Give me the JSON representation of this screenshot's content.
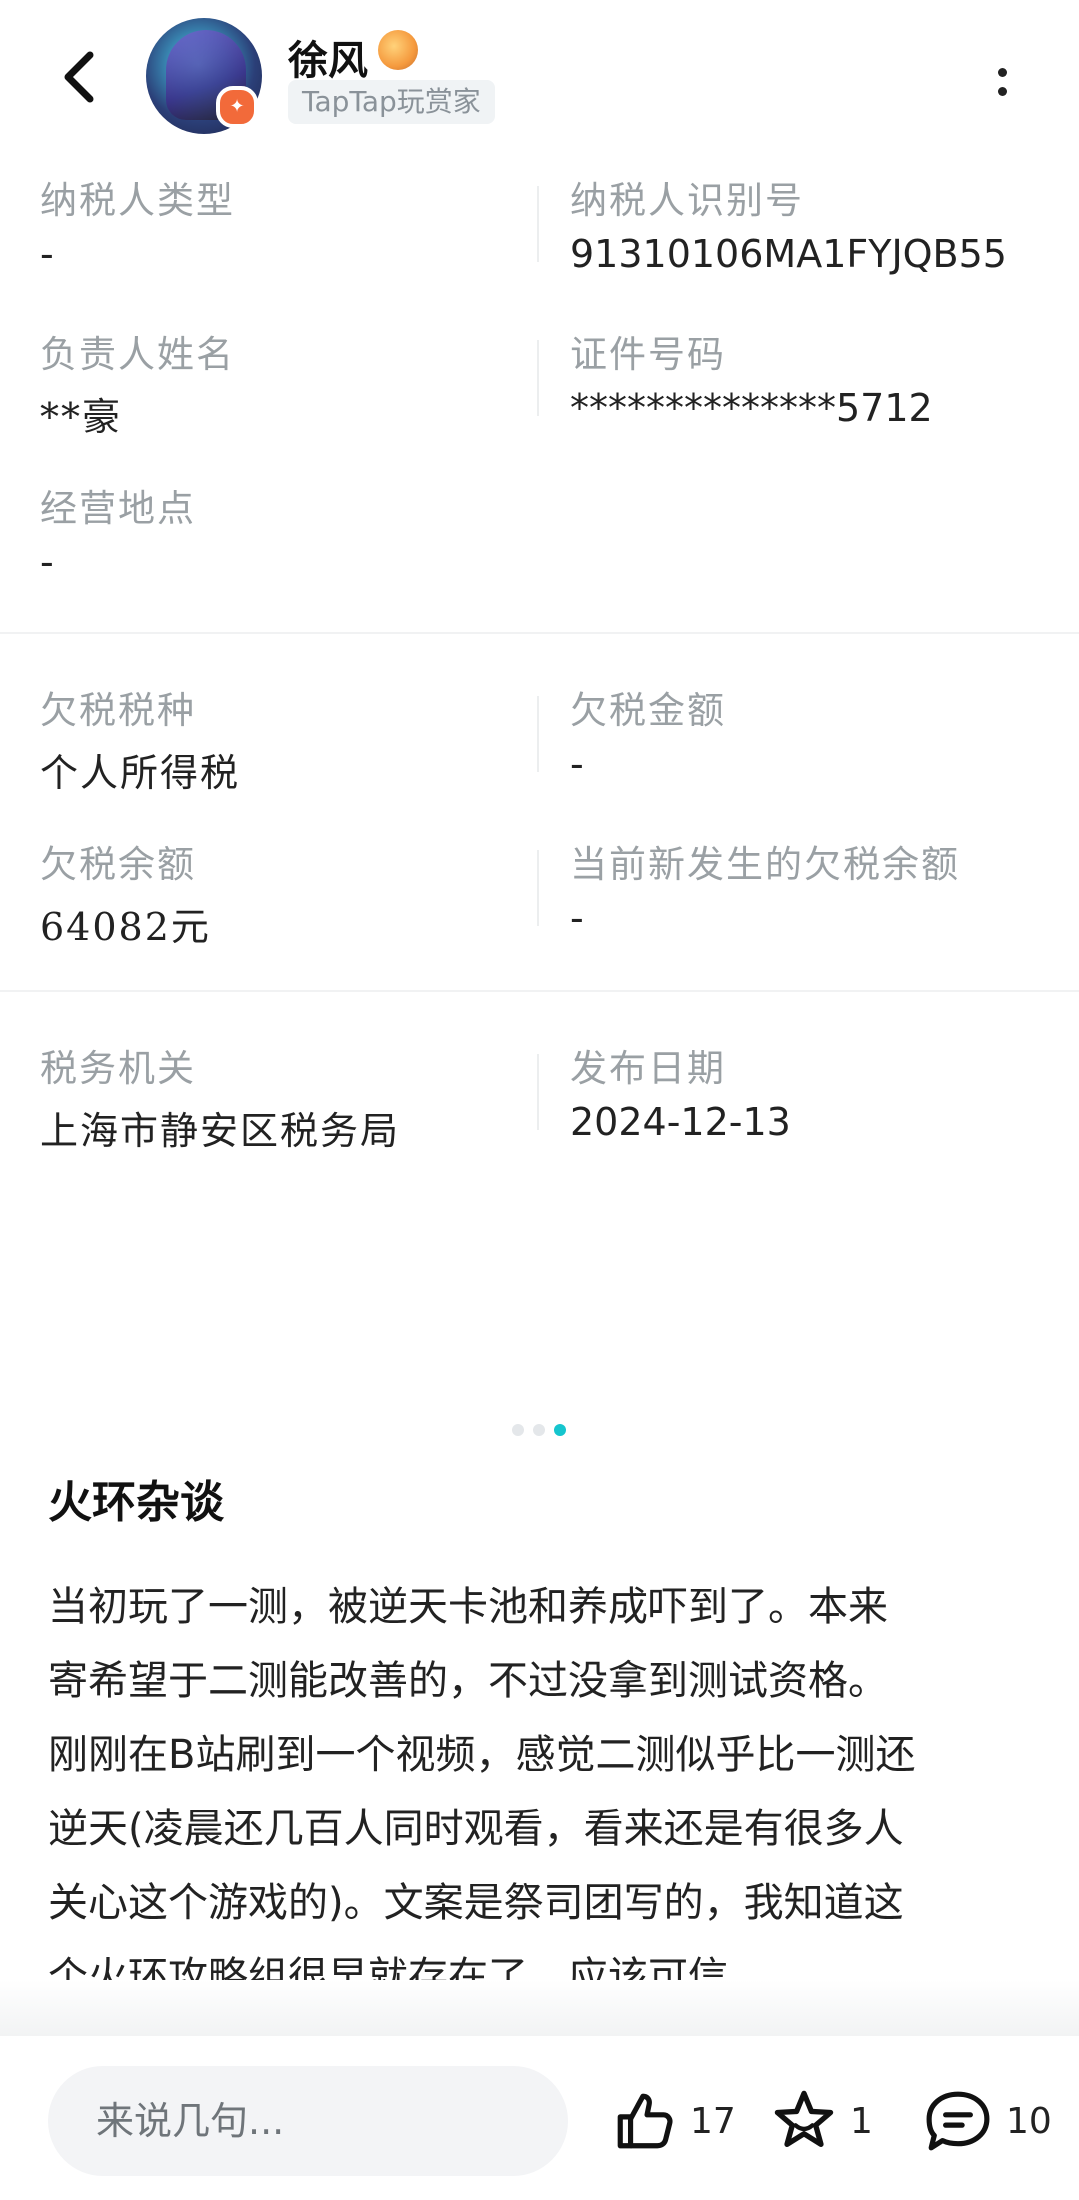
{
  "header": {
    "user_name": "徐风",
    "user_tag": "TapTap玩赏家",
    "back_icon": "chevron-left-icon",
    "more_icon": "more-vertical-icon"
  },
  "taxpayer": {
    "type_label": "纳税人类型",
    "type_value": "-",
    "id_label": "纳税人识别号",
    "id_value": "91310106MA1FYJQB55",
    "manager_label": "负责人姓名",
    "manager_value": "**豪",
    "cert_label": "证件号码",
    "cert_value": "**************5712",
    "location_label": "经营地点",
    "location_value": "-"
  },
  "arrears": {
    "tax_type_label": "欠税税种",
    "tax_type_value": "个人所得税",
    "amount_label": "欠税金额",
    "amount_value": "-",
    "balance_label": "欠税余额",
    "balance_value": "64082元",
    "new_balance_label": "当前新发生的欠税余额",
    "new_balance_value": "-"
  },
  "authority": {
    "org_label": "税务机关",
    "org_value": "上海市静安区税务局",
    "date_label": "发布日期",
    "date_value": "2024-12-13"
  },
  "pager": {
    "count": 3,
    "active": 3
  },
  "post": {
    "title": "火环杂谈",
    "lines": [
      "当初玩了一测，被逆天卡池和养成吓到了。本来",
      "寄希望于二测能改善的，不过没拿到测试资格。",
      "刚刚在B站刷到一个视频，感觉二测似乎比一测还",
      "逆天(凌晨还几百人同时观看，看来还是有很多人",
      "关心这个游戏的)。文案是祭司团写的，我知道这",
      "个火环攻略组很早就存在了，应该可信。"
    ]
  },
  "bottom_bar": {
    "comment_placeholder": "来说几句...",
    "like_count": "17",
    "favorite_count": "1",
    "comment_count": "10"
  },
  "colors": {
    "accent": "#15c5ce",
    "label_gray": "#9aa0a4",
    "badge_orange": "#f26a3a"
  }
}
